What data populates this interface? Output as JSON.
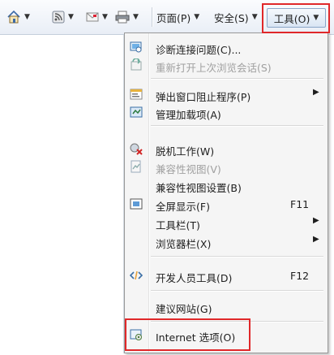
{
  "toolbar": {
    "page_label": "页面(P)",
    "safety_label": "安全(S)",
    "tools_label": "工具(O)"
  },
  "menu": {
    "items": [
      {
        "label": "诊断连接问题(C)...",
        "shortcut": "",
        "icon": "diagnose-icon"
      },
      {
        "label": "重新打开上次浏览会话(S)",
        "shortcut": "",
        "icon": "reopen-session-icon",
        "disabled": true
      },
      {
        "label": "弹出窗口阻止程序(P)",
        "shortcut": "",
        "icon": "popup-blocker-icon",
        "submenu": true
      },
      {
        "label": "管理加载项(A)",
        "shortcut": "",
        "icon": "addons-icon"
      },
      {
        "label": "脱机工作(W)",
        "shortcut": "",
        "icon": "offline-icon"
      },
      {
        "label": "兼容性视图(V)",
        "shortcut": "",
        "icon": "compat-view-icon",
        "disabled": true
      },
      {
        "label": "兼容性视图设置(B)",
        "shortcut": "",
        "icon": ""
      },
      {
        "label": "全屏显示(F)",
        "shortcut": "F11",
        "icon": "fullscreen-icon"
      },
      {
        "label": "工具栏(T)",
        "shortcut": "",
        "icon": "",
        "submenu": true
      },
      {
        "label": "浏览器栏(X)",
        "shortcut": "",
        "icon": "",
        "submenu": true
      },
      {
        "label": "开发人员工具(D)",
        "shortcut": "F12",
        "icon": "devtools-icon"
      },
      {
        "label": "建议网站(G)",
        "shortcut": "",
        "icon": ""
      },
      {
        "label": "Internet 选项(O)",
        "shortcut": "",
        "icon": "internet-options-icon"
      }
    ]
  },
  "colors": {
    "highlight_box": "#e0282a",
    "menu_bg": "#f5f5f5"
  }
}
